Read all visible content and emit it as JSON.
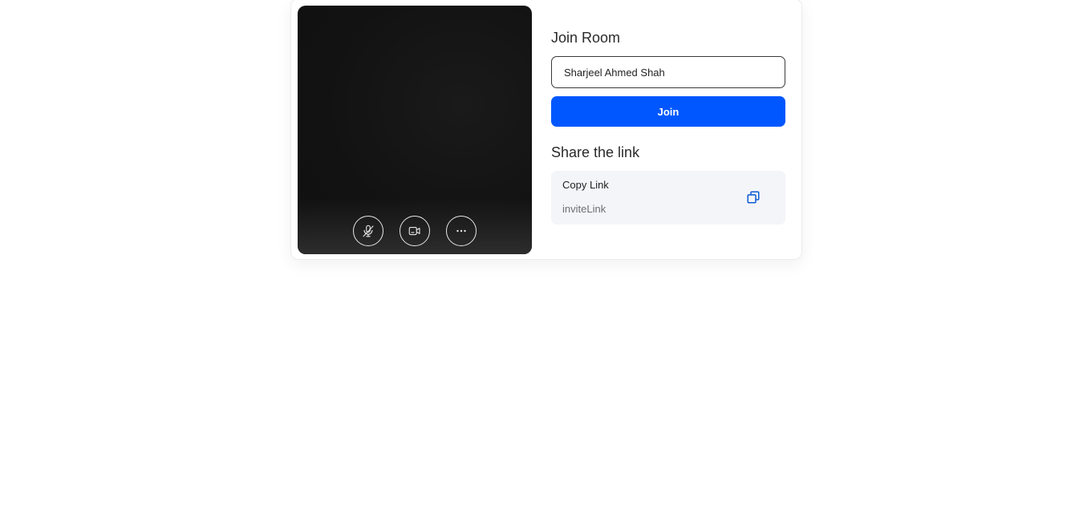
{
  "preview": {
    "controls": [
      {
        "icon": "mic-off-icon"
      },
      {
        "icon": "camera-icon"
      },
      {
        "icon": "more-options-icon"
      }
    ]
  },
  "join": {
    "title": "Join Room",
    "name_value": "Sharjeel Ahmed Shah",
    "button_label": "Join"
  },
  "share": {
    "title": "Share the link",
    "copy_label": "Copy Link",
    "link_value": "inviteLink"
  },
  "colors": {
    "primary": "#0057ff",
    "preview_bg": "#121212",
    "link_box_bg": "#f4f5f9"
  }
}
